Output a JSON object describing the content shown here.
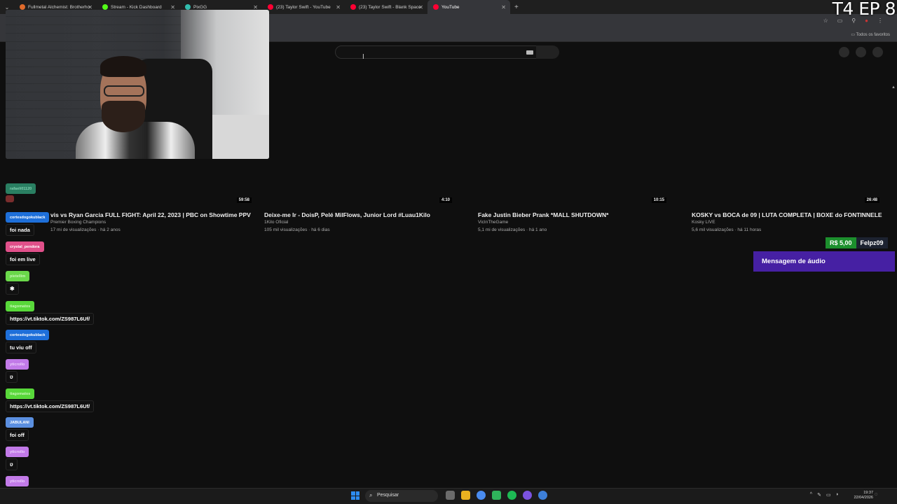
{
  "stream": {
    "episode_label": "T4 EP 8"
  },
  "browser": {
    "tabs": [
      {
        "label": "Fullmetal Alchemist: Brotherho",
        "favicon_color": "#e06a2b",
        "active": false
      },
      {
        "label": "Stream - Kick Dashboard",
        "favicon_color": "#53fc18",
        "active": false
      },
      {
        "label": "PixGG",
        "favicon_color": "#32bcad",
        "active": false
      },
      {
        "label": "(23) Taylor Swift - YouTube",
        "favicon_color": "#ff0033",
        "active": false
      },
      {
        "label": "(23) Taylor Swift - Blank Space",
        "favicon_color": "#ff0033",
        "active": false
      },
      {
        "label": "YouTube",
        "favicon_color": "#ff0033",
        "active": true
      }
    ],
    "new_tab_icon": "+",
    "bookmarks_all_label": "Todos os favoritos"
  },
  "youtube": {
    "search_placeholder": "",
    "videos": [
      {
        "duration": "59:58",
        "title": "vis vs Ryan Garcia FULL FIGHT: April 22, 2023 | PBC on Showtime PPV",
        "channel": "Premier Boxing Champions",
        "meta": "17 mi de visualizações · há 2 anos"
      },
      {
        "duration": "4:10",
        "title": "Deixe-me Ir - DoisP, Pelé MilFlows, Junior Lord #Luau1Kilo",
        "channel": "1Kilo Oficial",
        "meta": "105 mil visualizações · há 6 dias"
      },
      {
        "duration": "10:15",
        "title": "Fake Justin Bieber Prank *MALL SHUTDOWN*",
        "channel": "VicInTheGame",
        "meta": "5,1 mi de visualizações · há 1 ano"
      },
      {
        "duration": "26:48",
        "title": "KOSKY vs BOCA de 09 | LUTA COMPLETA | BOXE do FONTINNELE",
        "channel": "Kosky LIVE",
        "meta": "5,6 mil visualizações · há 11 horas"
      }
    ]
  },
  "donation": {
    "amount": "R$ 5,00",
    "user": "Felpz09",
    "message_type": "Mensagem de áudio",
    "colors": {
      "amount_bg": "#1c8f2d",
      "message_bg": "#4620a3"
    }
  },
  "chat": [
    {
      "user": "rafaeli01120",
      "msg": "",
      "color": "#2a7f62"
    },
    {
      "user": "",
      "msg": "",
      "color": "#7a2d2d",
      "emote": "emote-icon"
    },
    {
      "user": "cortesdogokublack",
      "msg": "foi nada",
      "color": "#1e6fd9"
    },
    {
      "user": "crystal_pendora",
      "msg": "foi em live",
      "color": "#e0508a"
    },
    {
      "user": "pietellim",
      "msg": "",
      "color": "#6ad84a",
      "emote": "emote-icon"
    },
    {
      "user": "tiagomatos",
      "msg": "https://vt.tiktok.com/ZS987L6Uf/",
      "color": "#58d83a"
    },
    {
      "user": "cortesdogokublack",
      "msg": "tu viu off",
      "color": "#1e6fd9"
    },
    {
      "user": "yticrollo",
      "msg": "",
      "color": "#c27ae8",
      "emote": "emote-icon"
    },
    {
      "user": "tiagomatos",
      "msg": "https://vt.tiktok.com/ZS987L6Uf/",
      "color": "#58d83a"
    },
    {
      "user": "JABULANI",
      "msg": "foi off",
      "color": "#5b8fe0"
    },
    {
      "user": "yticrollo",
      "msg": "",
      "color": "#c27ae8",
      "emote": "emote-icon"
    },
    {
      "user": "yticrollo",
      "msg": "",
      "color": "#c27ae8",
      "emote": "emote-icon"
    }
  ],
  "taskbar": {
    "search_label": "Pesquisar",
    "time": "19:37",
    "date": "22/04/2026",
    "app_colors": [
      "#6b6b6b",
      "#e8b020",
      "#4a8cf0",
      "#2fb35b",
      "#1db954",
      "#7b52e0",
      "#3d7fd9"
    ]
  }
}
